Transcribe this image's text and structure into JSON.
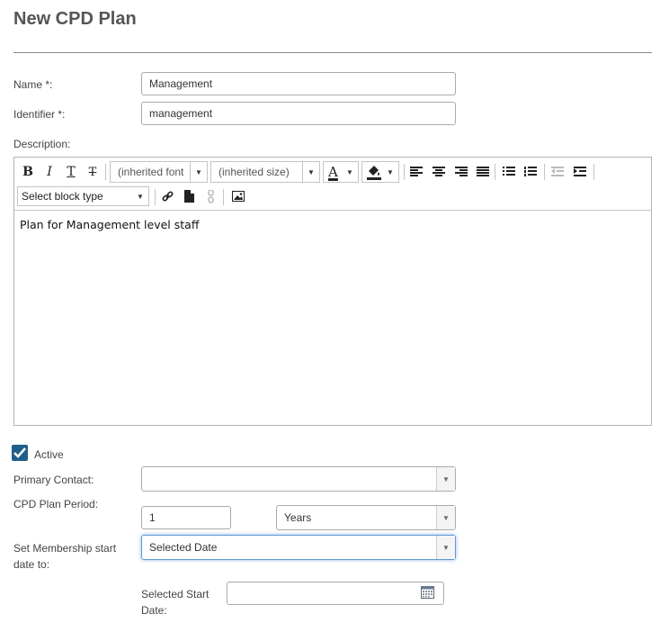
{
  "page": {
    "title": "New CPD Plan"
  },
  "form": {
    "name": {
      "label": "Name *:",
      "value": "Management"
    },
    "identifier": {
      "label": "Identifier *:",
      "value": "management"
    },
    "description": {
      "label": "Description:",
      "content": "Plan for Management level staff"
    },
    "active": {
      "label": "Active",
      "checked": true
    },
    "primary_contact": {
      "label": "Primary Contact:",
      "value": ""
    },
    "plan_period": {
      "label": "CPD Plan Period:",
      "amount": "1",
      "unit": "Years"
    },
    "membership_start": {
      "label_line1": "Set Membership start",
      "label_line2": "date to:",
      "value": "Selected Date"
    },
    "selected_start_date": {
      "label_line1": "Selected Start",
      "label_line2": "Date:",
      "value": ""
    }
  },
  "toolbar": {
    "bold": "B",
    "italic": "I",
    "underline": "T",
    "strikethrough": "T",
    "font_family": "(inherited font",
    "font_size": "(inherited size)",
    "font_color": "A",
    "block_type": "Select block type"
  },
  "colors": {
    "accent": "#1f5f8b",
    "border": "#aaaaaa",
    "title": "#555555"
  }
}
